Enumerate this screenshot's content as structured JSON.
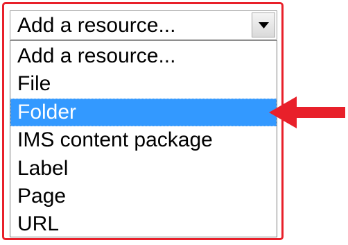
{
  "select": {
    "current_value": "Add a resource...",
    "icon": "chevron-down-icon"
  },
  "dropdown": {
    "options": [
      "Add a resource...",
      "File",
      "Folder",
      "IMS content package",
      "Label",
      "Page",
      "URL"
    ],
    "highlighted_option": "Folder"
  },
  "annotation": {
    "frame_color": "#e8202a",
    "arrow_color": "#e8202a",
    "arrow_icon": "left-arrow-icon"
  },
  "colors": {
    "selection_bg": "#3399ff",
    "selection_text": "#ffffff"
  }
}
